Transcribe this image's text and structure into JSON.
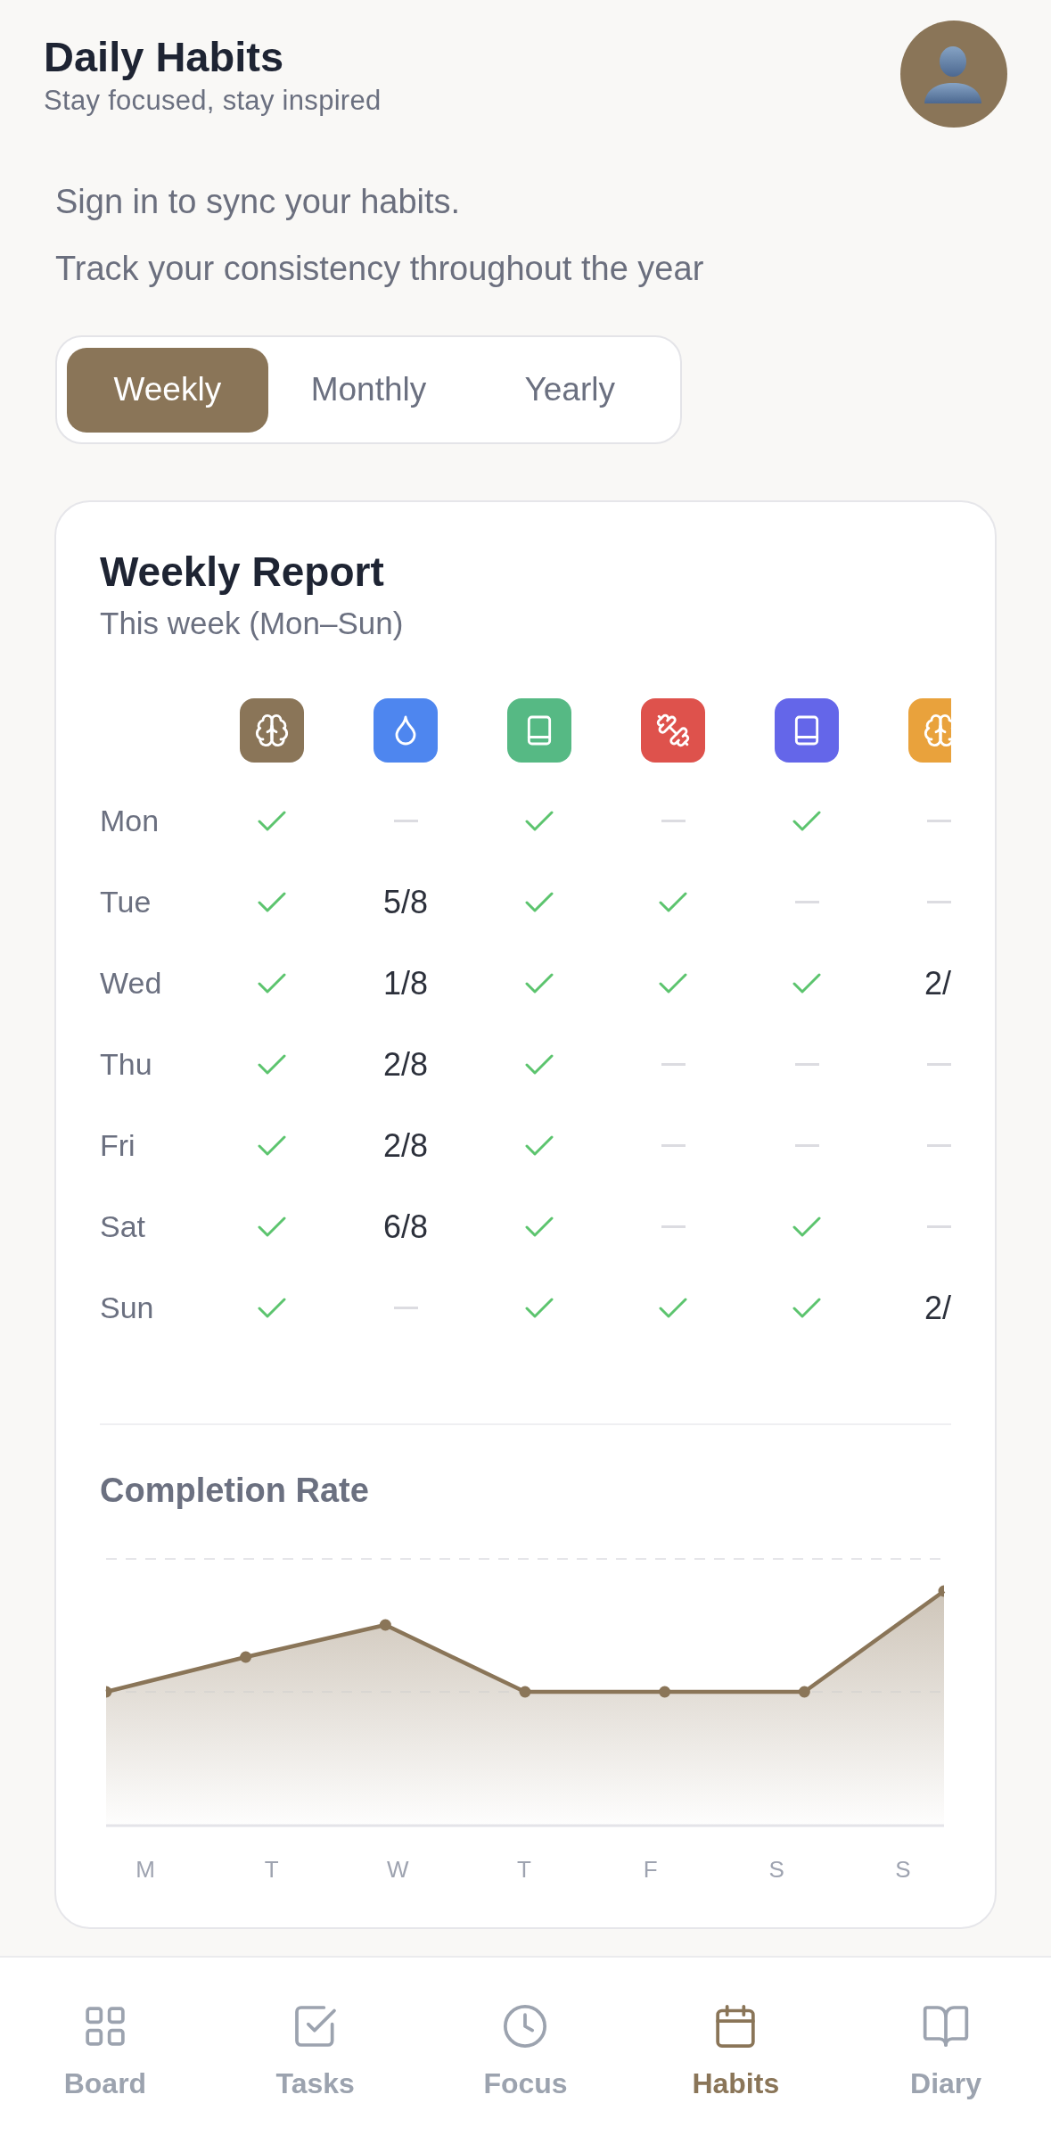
{
  "header": {
    "title": "Daily Habits",
    "subtitle": "Stay focused, stay inspired"
  },
  "sign_in_note": "Sign in to sync your habits.",
  "tagline": "Track your consistency throughout the year",
  "period_tabs": [
    {
      "label": "Weekly",
      "selected": true
    },
    {
      "label": "Monthly",
      "selected": false
    },
    {
      "label": "Yearly",
      "selected": false
    }
  ],
  "report": {
    "title": "Weekly Report",
    "subtitle": "This week (Mon–Sun)",
    "habits": [
      {
        "kind": "brain",
        "color": "#8a7558"
      },
      {
        "kind": "drop",
        "color": "#4e86ef"
      },
      {
        "kind": "book",
        "color": "#56b984"
      },
      {
        "kind": "dumbbell",
        "color": "#de524c"
      },
      {
        "kind": "book",
        "color": "#6466e9"
      },
      {
        "kind": "brain",
        "color": "#e9a23c"
      }
    ],
    "rows": [
      {
        "day": "Mon",
        "cells": [
          {
            "done": true
          },
          {
            "done": false
          },
          {
            "done": true
          },
          {
            "done": false
          },
          {
            "done": true
          },
          {
            "done": false
          }
        ]
      },
      {
        "day": "Tue",
        "cells": [
          {
            "done": true
          },
          {
            "count": "5/8"
          },
          {
            "done": true
          },
          {
            "done": true
          },
          {
            "done": false
          },
          {
            "done": false
          }
        ]
      },
      {
        "day": "Wed",
        "cells": [
          {
            "done": true
          },
          {
            "count": "1/8"
          },
          {
            "done": true
          },
          {
            "done": true
          },
          {
            "done": true
          },
          {
            "count": "2/"
          }
        ]
      },
      {
        "day": "Thu",
        "cells": [
          {
            "done": true
          },
          {
            "count": "2/8"
          },
          {
            "done": true
          },
          {
            "done": false
          },
          {
            "done": false
          },
          {
            "done": false
          }
        ]
      },
      {
        "day": "Fri",
        "cells": [
          {
            "done": true
          },
          {
            "count": "2/8"
          },
          {
            "done": true
          },
          {
            "done": false
          },
          {
            "done": false
          },
          {
            "done": false
          }
        ]
      },
      {
        "day": "Sat",
        "cells": [
          {
            "done": true
          },
          {
            "count": "6/8"
          },
          {
            "done": true
          },
          {
            "done": false
          },
          {
            "done": true
          },
          {
            "done": false
          }
        ]
      },
      {
        "day": "Sun",
        "cells": [
          {
            "done": true
          },
          {
            "done": false
          },
          {
            "done": true
          },
          {
            "done": true
          },
          {
            "done": true
          },
          {
            "count": "2/"
          }
        ]
      }
    ],
    "completion": {
      "title": "Completion Rate",
      "day_labels": [
        "M",
        "T",
        "W",
        "T",
        "F",
        "S",
        "S"
      ]
    }
  },
  "nav": [
    {
      "label": "Board",
      "kind": "grid",
      "selected": false
    },
    {
      "label": "Tasks",
      "kind": "tasks",
      "selected": false
    },
    {
      "label": "Focus",
      "kind": "clock",
      "selected": false
    },
    {
      "label": "Habits",
      "kind": "calendar",
      "selected": true
    },
    {
      "label": "Diary",
      "kind": "book",
      "selected": false
    }
  ]
}
